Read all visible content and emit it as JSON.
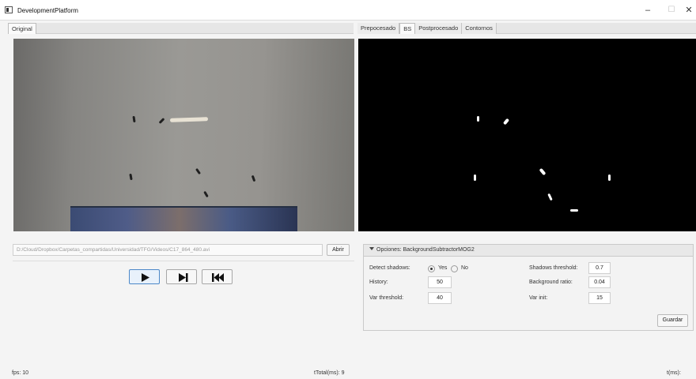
{
  "window": {
    "title": "DevelopmentPlatform",
    "controls": {
      "minimize": "–",
      "maximize": "☐",
      "close": "✕"
    }
  },
  "left_tabs": [
    {
      "label": "Original",
      "active": true
    }
  ],
  "right_tabs": [
    {
      "label": "Prepocesado",
      "active": false
    },
    {
      "label": "BS",
      "active": true
    },
    {
      "label": "Postprocesado",
      "active": false
    },
    {
      "label": "Contornos",
      "active": false
    }
  ],
  "file": {
    "path": "D:/Cloud/Dropbox/Carpetas_compartidas/Universidad/TFG/Videos/C17_864_480.avi",
    "open_label": "Abrir"
  },
  "media_buttons": {
    "play": "play-icon",
    "step": "step-forward-icon",
    "rewind": "rewind-icon"
  },
  "options": {
    "title": "Opciones: BackgroundSubtractorMOG2",
    "detect_shadows": {
      "label": "Detect shadows:",
      "yes": "Yes",
      "no": "No",
      "selected": "Yes"
    },
    "history": {
      "label": "History:",
      "value": "50"
    },
    "var_threshold": {
      "label": "Var threshold:",
      "value": "40"
    },
    "shadows_threshold": {
      "label": "Shadows threshold:",
      "value": "0.7"
    },
    "background_ratio": {
      "label": "Background ratio:",
      "value": "0.04"
    },
    "var_init": {
      "label": "Var init:",
      "value": "15"
    },
    "save_label": "Guardar"
  },
  "status": {
    "fps": "fps: 10",
    "ttotal": "tTotal(ms):  9",
    "t": "t(ms):"
  },
  "colors": {
    "accent": "#4c88c8",
    "mask_bg": "#000000",
    "panel_bg": "#f4f4f4"
  }
}
